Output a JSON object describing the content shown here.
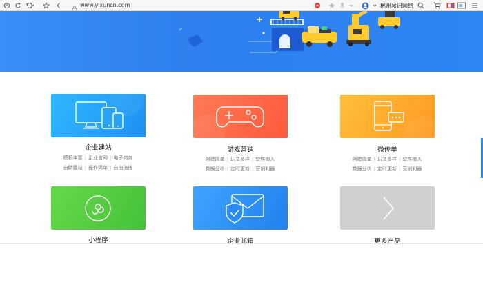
{
  "browser": {
    "url": "www.yixuncn.com",
    "profile_name": "郴州易讯网络",
    "icons": [
      "back-arrow-icon",
      "refresh-icon",
      "undo-icon",
      "star-icon",
      "prev-icon",
      "lock-icon",
      "shield-icon",
      "star-outline-icon",
      "mic-icon",
      "avatar-icon",
      "search-icon",
      "cart-icon",
      "extension-icon",
      "window-icon"
    ]
  },
  "colors": {
    "hero_blue": "#2f7ff0",
    "tile_blue": "#28a3f7",
    "tile_orange_red": "#ff6b4a",
    "tile_orange": "#ffab2b",
    "tile_green": "#55cc40",
    "tile_mid_blue": "#2c8df5",
    "tile_gray": "#cfcfcf"
  },
  "products": [
    {
      "title": "企业建站",
      "icon": "devices-icon",
      "rows": [
        [
          "模板丰富",
          "企业官网",
          "电子商务"
        ],
        [
          "自助建站",
          "操作简单",
          "自由拖拽"
        ]
      ]
    },
    {
      "title": "游戏营销",
      "icon": "gamepad-icon",
      "rows": [
        [
          "创建简单",
          "玩法多样",
          "软性植入"
        ],
        [
          "数据分析",
          "定时更新",
          "营销利器"
        ]
      ]
    },
    {
      "title": "微传单",
      "icon": "phone-chat-icon",
      "rows": [
        [
          "创建简单",
          "玩法多样",
          "软性植入"
        ],
        [
          "数据分析",
          "定时更新",
          "营销利器"
        ]
      ]
    },
    {
      "title": "小程序",
      "icon": "mini-program-icon",
      "rows": []
    },
    {
      "title": "企业邮箱",
      "icon": "mail-shield-icon",
      "rows": []
    },
    {
      "title": "更多产品",
      "icon": "chevron-right-icon",
      "rows": []
    }
  ]
}
